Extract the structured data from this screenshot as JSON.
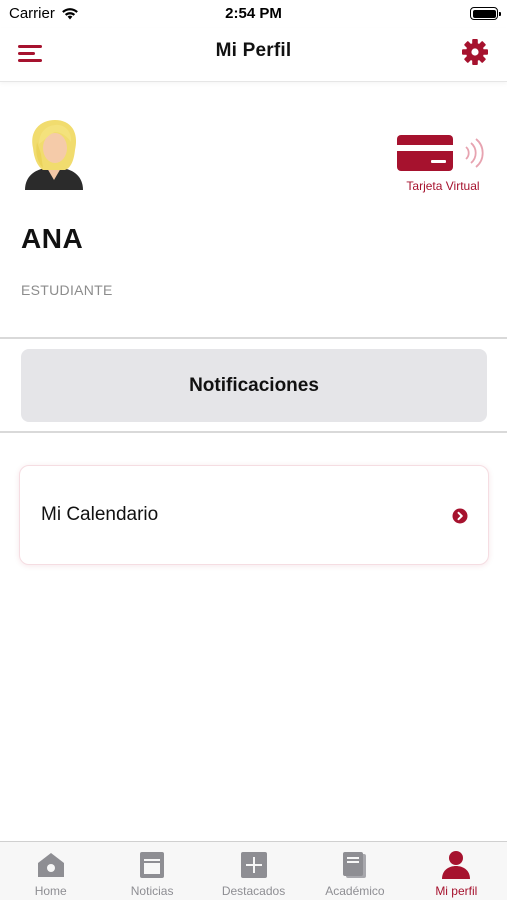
{
  "status_bar": {
    "carrier": "Carrier",
    "time": "2:54 PM"
  },
  "nav": {
    "title": "Mi Perfil",
    "menu_icon": "hamburger-menu-icon",
    "settings_icon": "gear-icon"
  },
  "profile": {
    "name": "ANA",
    "role": "ESTUDIANTE",
    "virtual_card_label": "Tarjeta Virtual"
  },
  "notifications_button": "Notificaciones",
  "calendar": {
    "label": "Mi Calendario"
  },
  "tabs": [
    {
      "label": "Home",
      "icon": "home-icon",
      "active": false
    },
    {
      "label": "Noticias",
      "icon": "news-icon",
      "active": false
    },
    {
      "label": "Destacados",
      "icon": "plus-square-icon",
      "active": false
    },
    {
      "label": "Académico",
      "icon": "book-icon",
      "active": false
    },
    {
      "label": "Mi perfil",
      "icon": "person-icon",
      "active": true
    }
  ],
  "colors": {
    "accent": "#a6122e",
    "inactive_tab": "#8e8e93",
    "button_bg": "#e5e5e8"
  }
}
